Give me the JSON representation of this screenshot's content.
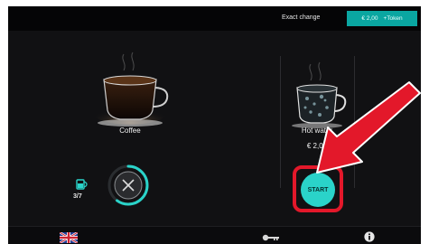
{
  "header": {
    "exact_change_label": "Exact change",
    "credit_amount": "€ 2,00",
    "token_label": "+Token"
  },
  "products": [
    {
      "name": "Coffee"
    },
    {
      "name": "Hot water",
      "price": "€ 2,00"
    }
  ],
  "order": {
    "cup_count": "3/7",
    "start_label": "START",
    "progress": 0.6
  },
  "footer": {
    "language": "English (UK flag)"
  },
  "colors": {
    "accent": "#2ad3c9",
    "highlight": "#e3182a",
    "background": "#111113"
  }
}
